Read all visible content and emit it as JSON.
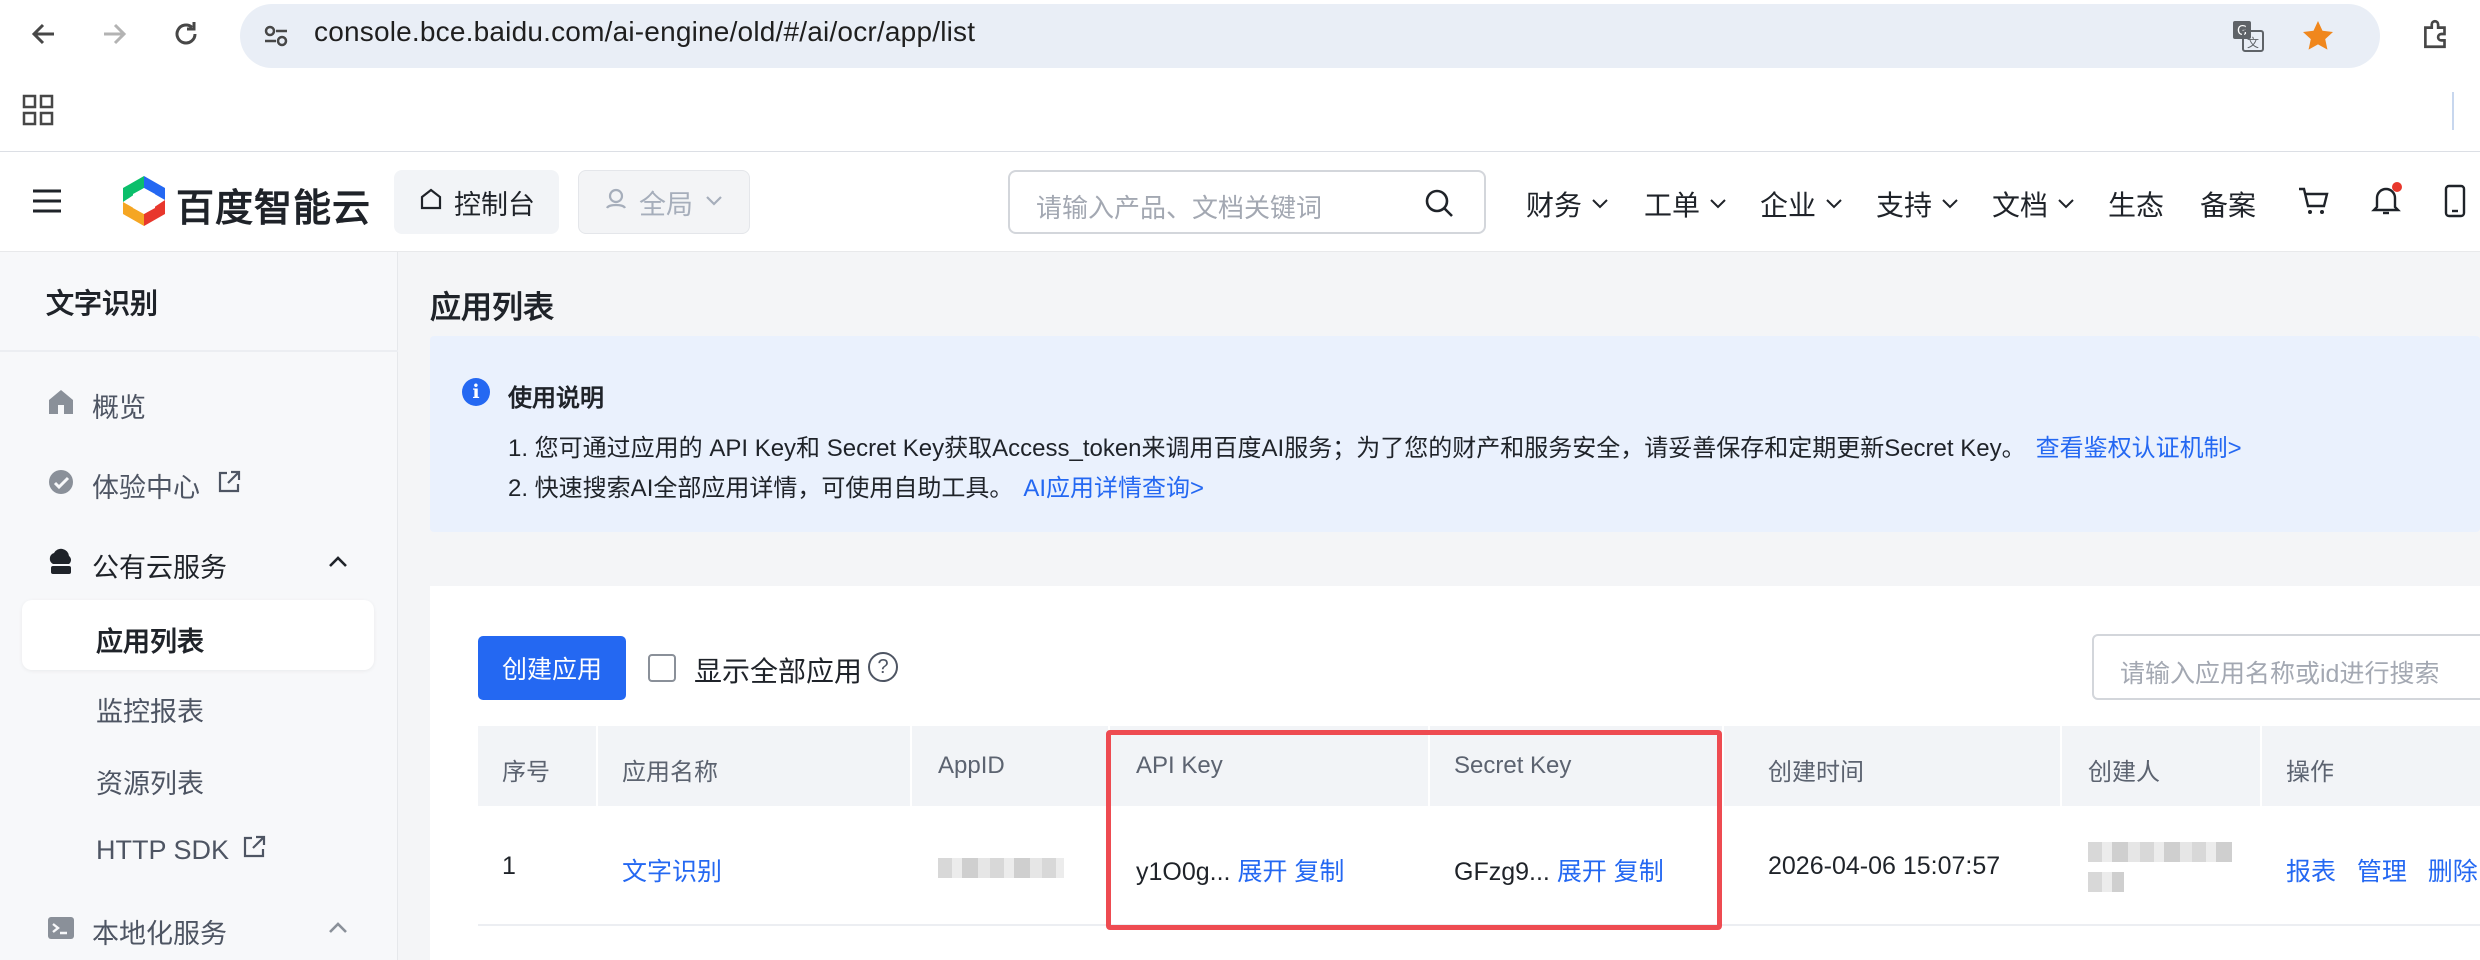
{
  "browser": {
    "url": "console.bce.baidu.com/ai-engine/old/#/ai/ocr/app/list",
    "colors": {
      "star": "#f0871d"
    }
  },
  "header": {
    "logo_text": "百度智能云",
    "console_label": "控制台",
    "region_label": "全局",
    "search_placeholder": "请输入产品、文档关键词",
    "nav": [
      "财务",
      "工单",
      "企业",
      "支持",
      "文档",
      "生态",
      "备案"
    ]
  },
  "sidebar": {
    "title": "文字识别",
    "items": {
      "overview": "概览",
      "experience": "体验中心",
      "public_cloud": "公有云服务",
      "app_list": "应用列表",
      "monitor": "监控报表",
      "resources": "资源列表",
      "http_sdk": "HTTP SDK",
      "local_service": "本地化服务"
    }
  },
  "main": {
    "title": "应用列表",
    "notice": {
      "title": "使用说明",
      "line1": "1. 您可通过应用的 API Key和 Secret Key获取Access_token来调用百度AI服务；为了您的财产和服务安全，请妥善保存和定期更新Secret Key。",
      "line1_link": "查看鉴权认证机制>",
      "line2": "2. 快速搜索AI全部应用详情，可使用自助工具。",
      "line2_link": "AI应用详情查询>"
    },
    "toolbar": {
      "create_button": "创建应用",
      "show_all_label": "显示全部应用",
      "help": "?",
      "search_placeholder": "请输入应用名称或id进行搜索"
    },
    "table": {
      "headers": [
        "序号",
        "应用名称",
        "AppID",
        "API Key",
        "Secret Key",
        "创建时间",
        "创建人",
        "操作"
      ],
      "rows": [
        {
          "index": "1",
          "name": "文字识别",
          "api_key": "y1O0g...",
          "secret_key": "GFzg9...",
          "expand": "展开",
          "copy": "复制",
          "created": "2026-04-06 15:07:57",
          "actions": [
            "报表",
            "管理",
            "删除"
          ]
        }
      ]
    }
  },
  "colors": {
    "primary": "#2468f2",
    "highlight": "#ee4b51",
    "notice_bg": "#eaf1fd"
  }
}
